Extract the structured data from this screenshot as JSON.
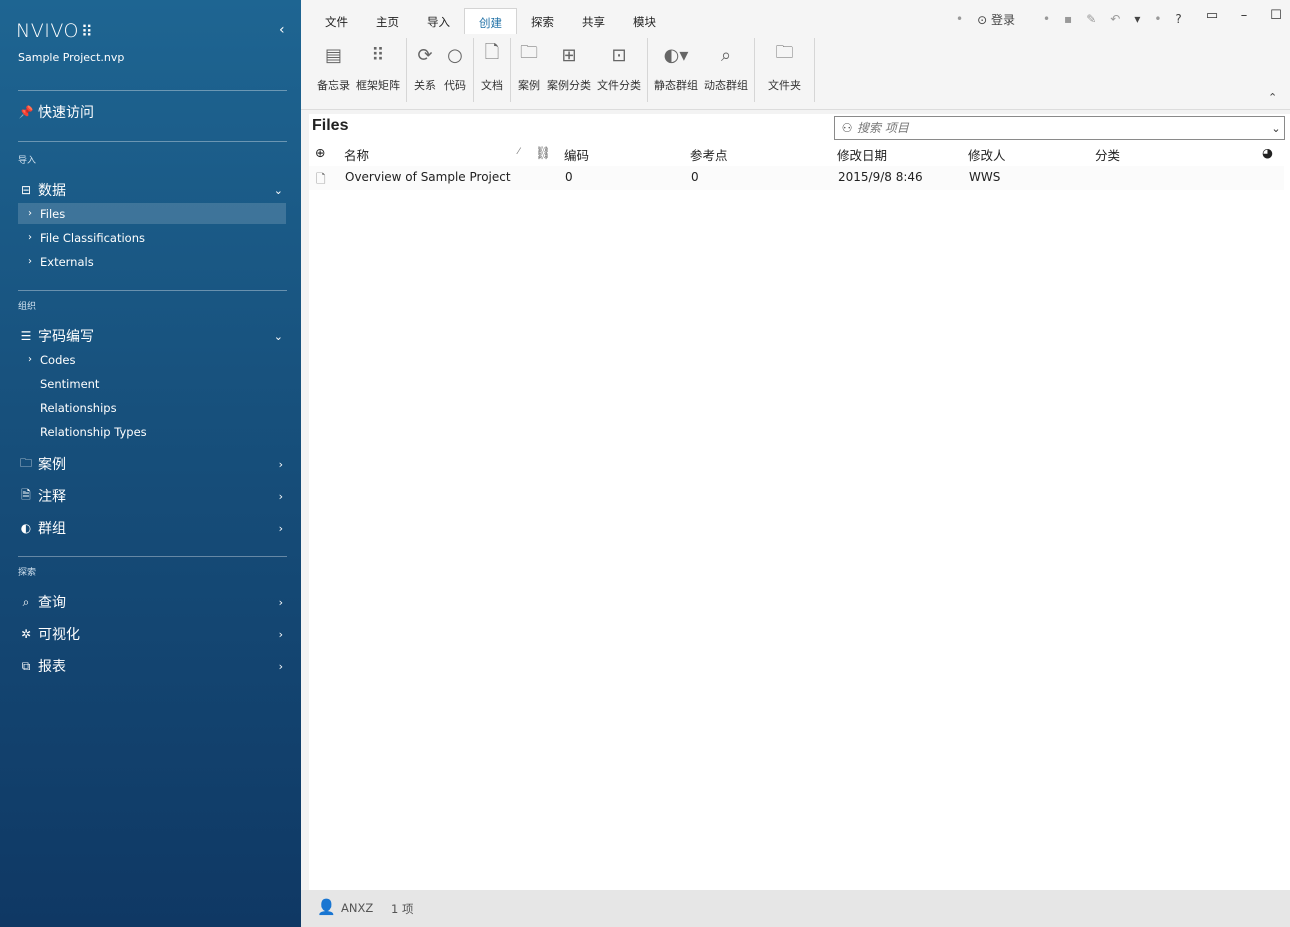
{
  "app": {
    "logo_text": "NVIVO",
    "logo_mark": "⠿",
    "project_name": "Sample Project.nvp"
  },
  "sidebar": {
    "quick_access": "快速访问",
    "section_import": "导入",
    "data_label": "数据",
    "data_items": [
      "Files",
      "File Classifications",
      "Externals"
    ],
    "section_organize": "组织",
    "coding_label": "字码编写",
    "coding_items": [
      "Codes",
      "Sentiment",
      "Relationships",
      "Relationship Types"
    ],
    "cases_label": "案例",
    "notes_label": "注释",
    "sets_label": "群组",
    "section_explore": "探索",
    "query_label": "查询",
    "visualize_label": "可视化",
    "reports_label": "报表"
  },
  "ribbon": {
    "tabs": [
      "文件",
      "主页",
      "导入",
      "创建",
      "探索",
      "共享",
      "模块"
    ],
    "active_tab": "创建",
    "login": "登录",
    "buttons": {
      "memo": "备忘录",
      "framework": "框架矩阵",
      "relationship": "关系",
      "code": "代码",
      "document": "文档",
      "case": "案例",
      "case_class": "案例分类",
      "file_class": "文件分类",
      "static_set": "静态群组",
      "dynamic_set": "动态群组",
      "folder": "文件夹"
    }
  },
  "main": {
    "title": "Files",
    "search_placeholder": "搜索 项目",
    "columns": {
      "name": "名称",
      "codes": "编码",
      "references": "参考点",
      "modified_on": "修改日期",
      "modified_by": "修改人",
      "classification": "分类"
    },
    "rows": [
      {
        "name": "Overview of Sample Project",
        "codes": "0",
        "references": "0",
        "modified_on": "2015/9/8 8:46",
        "modified_by": "WWS",
        "classification": ""
      }
    ]
  },
  "status": {
    "user": "ANXZ",
    "count": "1 项"
  }
}
